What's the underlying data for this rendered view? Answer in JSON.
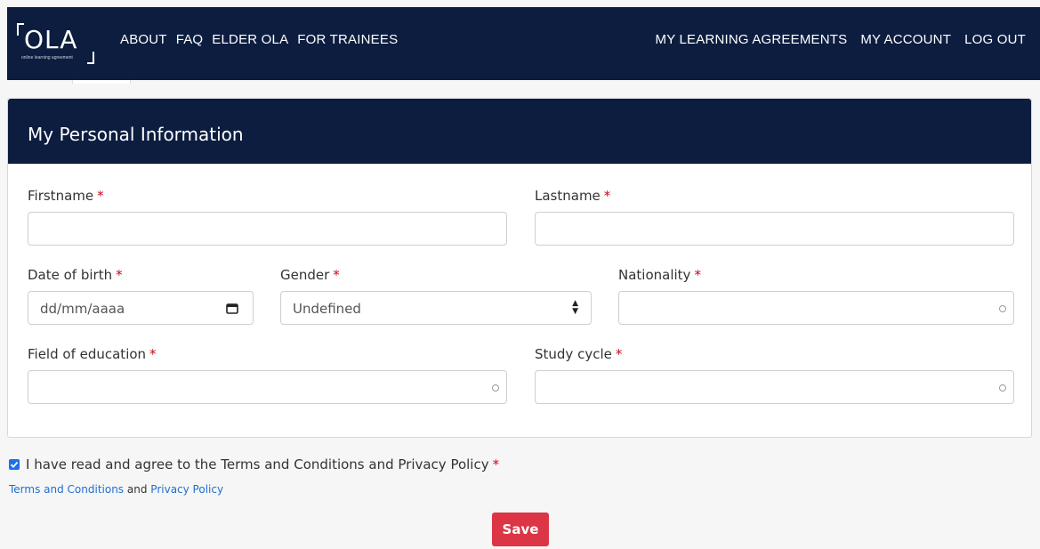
{
  "brand": {
    "logo_text": "OLA",
    "logo_subtitle": "online learning agreement"
  },
  "nav": {
    "left": [
      "ABOUT",
      "FAQ",
      "ELDER OLA",
      "FOR TRAINEES"
    ],
    "right": [
      "MY LEARNING AGREEMENTS",
      "MY ACCOUNT",
      "LOG OUT"
    ]
  },
  "card": {
    "title": "My Personal Information"
  },
  "form": {
    "required_mark": "*",
    "firstname": {
      "label": "Firstname",
      "value": ""
    },
    "lastname": {
      "label": "Lastname",
      "value": ""
    },
    "date_of_birth": {
      "label": "Date of birth",
      "placeholder": "dd/mm/aaaa"
    },
    "gender": {
      "label": "Gender",
      "selected": "Undefined"
    },
    "nationality": {
      "label": "Nationality",
      "value": ""
    },
    "field_of_education": {
      "label": "Field of education",
      "value": ""
    },
    "study_cycle": {
      "label": "Study cycle",
      "value": ""
    }
  },
  "agreement": {
    "checked": true,
    "text": "I have read and agree to the Terms and Conditions and Privacy Policy",
    "terms_link": "Terms and Conditions",
    "and_text": "and",
    "privacy_link": "Privacy Policy"
  },
  "actions": {
    "save_label": "Save"
  },
  "colors": {
    "header_bg": "#0c1d3f",
    "required": "#d0021b",
    "save_button": "#dc3545",
    "link": "#1f6fd0",
    "checkbox": "#1f6feb"
  },
  "icons": {
    "date": "calendar-icon",
    "select": "select-arrows-icon",
    "autocomplete": "loading-circle-icon",
    "checkbox": "check-icon"
  }
}
